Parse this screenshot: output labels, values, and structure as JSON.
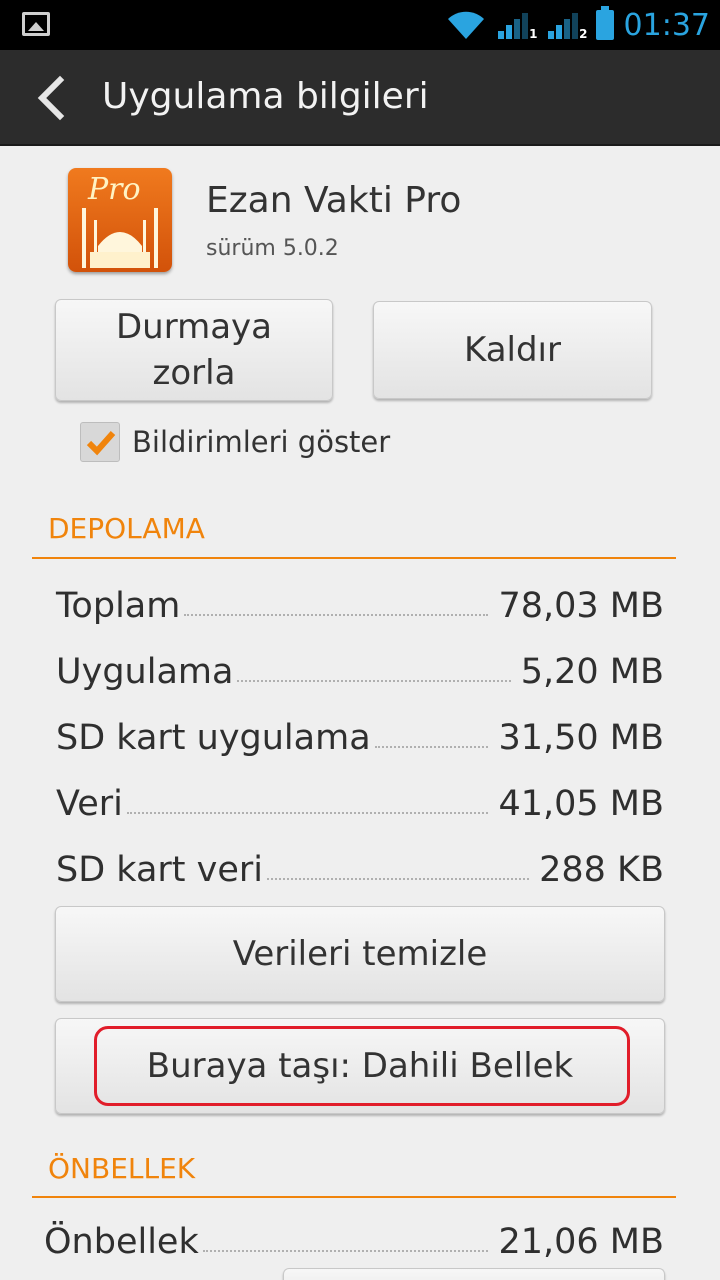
{
  "status_bar": {
    "time": "01:37",
    "sim1": "1",
    "sim2": "2",
    "colors": {
      "accent": "#2aa4e0"
    }
  },
  "action_bar": {
    "title": "Uygulama bilgileri"
  },
  "app": {
    "icon_text": "Pro",
    "name": "Ezan Vakti Pro",
    "version": "sürüm 5.0.2"
  },
  "buttons": {
    "force_stop": "Durmaya zorla",
    "uninstall": "Kaldır"
  },
  "notifications": {
    "label": "Bildirimleri göster",
    "checked": true
  },
  "storage": {
    "title": "DEPOLAMA",
    "rows": [
      {
        "label": "Toplam",
        "value": "78,03 MB"
      },
      {
        "label": "Uygulama",
        "value": "5,20 MB"
      },
      {
        "label": "SD kart uygulama",
        "value": "31,50 MB"
      },
      {
        "label": "Veri",
        "value": "41,05 MB"
      },
      {
        "label": "SD kart veri",
        "value": "288 KB"
      }
    ],
    "clear_data": "Verileri temizle",
    "move_to": "Buraya taşı: Dahili Bellek"
  },
  "cache": {
    "title": "ÖNBELLEK",
    "rows": [
      {
        "label": "Önbellek",
        "value": "21,06 MB"
      }
    ]
  },
  "colors": {
    "section": "#f0840c",
    "highlight": "#e11d2a"
  }
}
